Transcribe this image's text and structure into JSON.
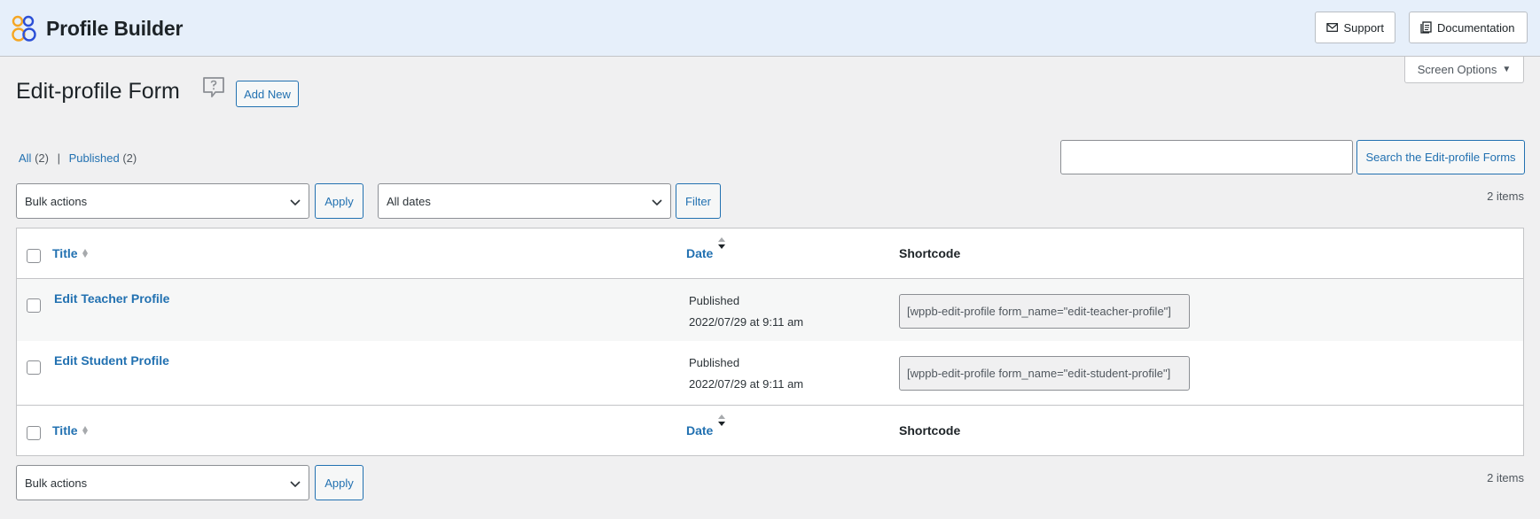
{
  "header": {
    "app_name": "Profile Builder",
    "logo_icon": "profile-builder-logo-icon",
    "support_label": "Support",
    "documentation_label": "Documentation"
  },
  "screen_options": {
    "label": "Screen Options"
  },
  "page": {
    "title": "Edit-profile Form",
    "add_new_label": "Add New"
  },
  "views": {
    "all_label": "All",
    "all_count": "(2)",
    "separator": "|",
    "published_label": "Published",
    "published_count": "(2)"
  },
  "search": {
    "value": "",
    "button_label": "Search the Edit-profile Forms"
  },
  "tablenav_top": {
    "bulk_actions": "Bulk actions",
    "apply_label": "Apply",
    "date_filter": "All dates",
    "filter_label": "Filter",
    "items_count": "2 items"
  },
  "table": {
    "columns": {
      "title": "Title",
      "date": "Date",
      "shortcode": "Shortcode"
    },
    "rows": [
      {
        "title": "Edit Teacher Profile",
        "status": "Published",
        "date": "2022/07/29 at 9:11 am",
        "shortcode": "[wppb-edit-profile form_name=\"edit-teacher-profile\"]"
      },
      {
        "title": "Edit Student Profile",
        "status": "Published",
        "date": "2022/07/29 at 9:11 am",
        "shortcode": "[wppb-edit-profile form_name=\"edit-student-profile\"]"
      }
    ]
  },
  "tablenav_bottom": {
    "bulk_actions": "Bulk actions",
    "apply_label": "Apply",
    "items_count": "2 items"
  },
  "colors": {
    "accent": "#2271b1",
    "header_bg": "#e6effa",
    "page_bg": "#f0f0f1",
    "logo_orange": "#f5a623",
    "logo_blue": "#2b4fd6"
  }
}
